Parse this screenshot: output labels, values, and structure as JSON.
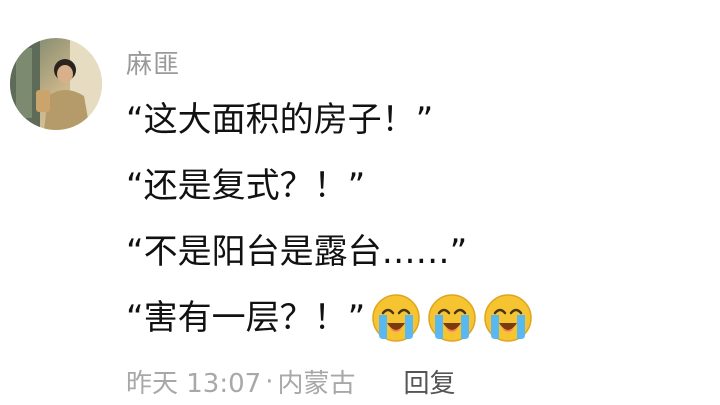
{
  "comment": {
    "username": "麻匪",
    "lines": [
      "“这大面积的房子！”",
      "“还是复式？！”",
      "“不是阳台是露台……”",
      "“害有一层？！”"
    ],
    "emoji_icons": [
      "loudly-crying-face-icon",
      "loudly-crying-face-icon",
      "loudly-crying-face-icon"
    ],
    "time": "昨天 13:07",
    "separator": "·",
    "location": "内蒙古",
    "reply_label": "回复"
  }
}
